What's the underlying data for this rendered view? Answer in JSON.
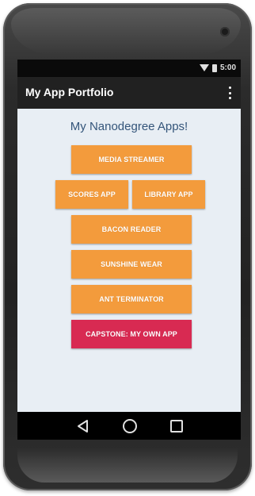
{
  "status_bar": {
    "time": "5:00",
    "icons": [
      "wifi-icon",
      "battery-icon"
    ]
  },
  "app_bar": {
    "title": "My App Portfolio",
    "menu_icon": "overflow-menu-icon"
  },
  "main": {
    "heading": "My Nanodegree Apps!",
    "buttons": {
      "media_streamer": "MEDIA STREAMER",
      "scores_app": "SCORES APP",
      "library_app": "LIBRARY APP",
      "bacon_reader": "BACON READER",
      "sunshine_wear": "SUNSHINE WEAR",
      "ant_terminator": "ANT TERMINATOR",
      "capstone": "CAPSTONE: MY OWN APP"
    }
  },
  "nav_bar": {
    "icons": [
      "back-icon",
      "home-icon",
      "recent-apps-icon"
    ]
  },
  "colors": {
    "primary_button": "#f39b3c",
    "accent_button": "#d82a52",
    "toolbar": "#212121",
    "background": "#e8eef4",
    "heading_text": "#34557a"
  }
}
